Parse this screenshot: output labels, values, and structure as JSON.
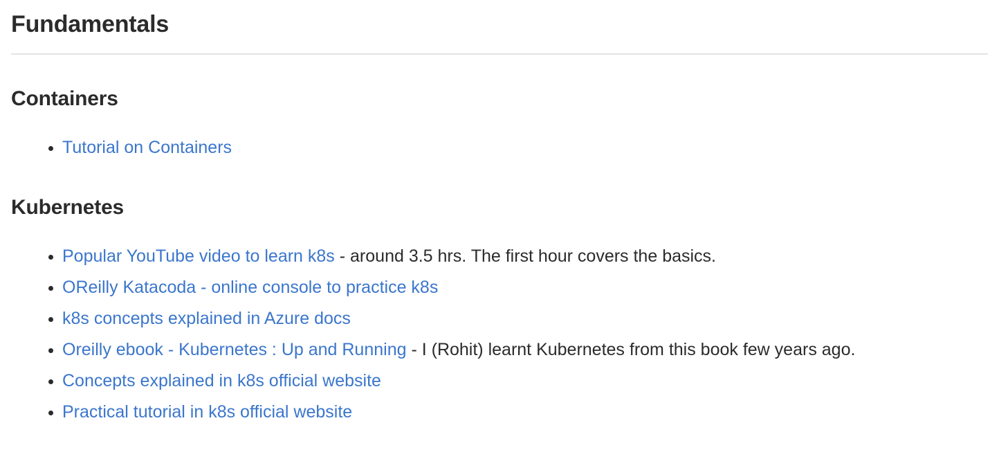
{
  "page": {
    "title": "Fundamentals"
  },
  "sections": [
    {
      "id": "containers",
      "heading": "Containers",
      "items": [
        {
          "link": "Tutorial on Containers",
          "suffix": ""
        }
      ]
    },
    {
      "id": "kubernetes",
      "heading": "Kubernetes",
      "items": [
        {
          "link": "Popular YouTube video to learn k8s",
          "suffix": " - around 3.5 hrs. The first hour covers the basics."
        },
        {
          "link": "OReilly Katacoda - online console to practice k8s",
          "suffix": ""
        },
        {
          "link": "k8s concepts explained in Azure docs",
          "suffix": ""
        },
        {
          "link": "Oreilly ebook - Kubernetes : Up and Running",
          "suffix": " - I (Rohit) learnt Kubernetes from this book few years ago."
        },
        {
          "link": "Concepts explained in k8s official website",
          "suffix": ""
        },
        {
          "link": "Practical tutorial in k8s official website",
          "suffix": ""
        }
      ]
    }
  ],
  "colors": {
    "link": "#3b76cc",
    "text": "#2b2b2b",
    "rule": "#e4e4e7",
    "background": "#ffffff"
  }
}
